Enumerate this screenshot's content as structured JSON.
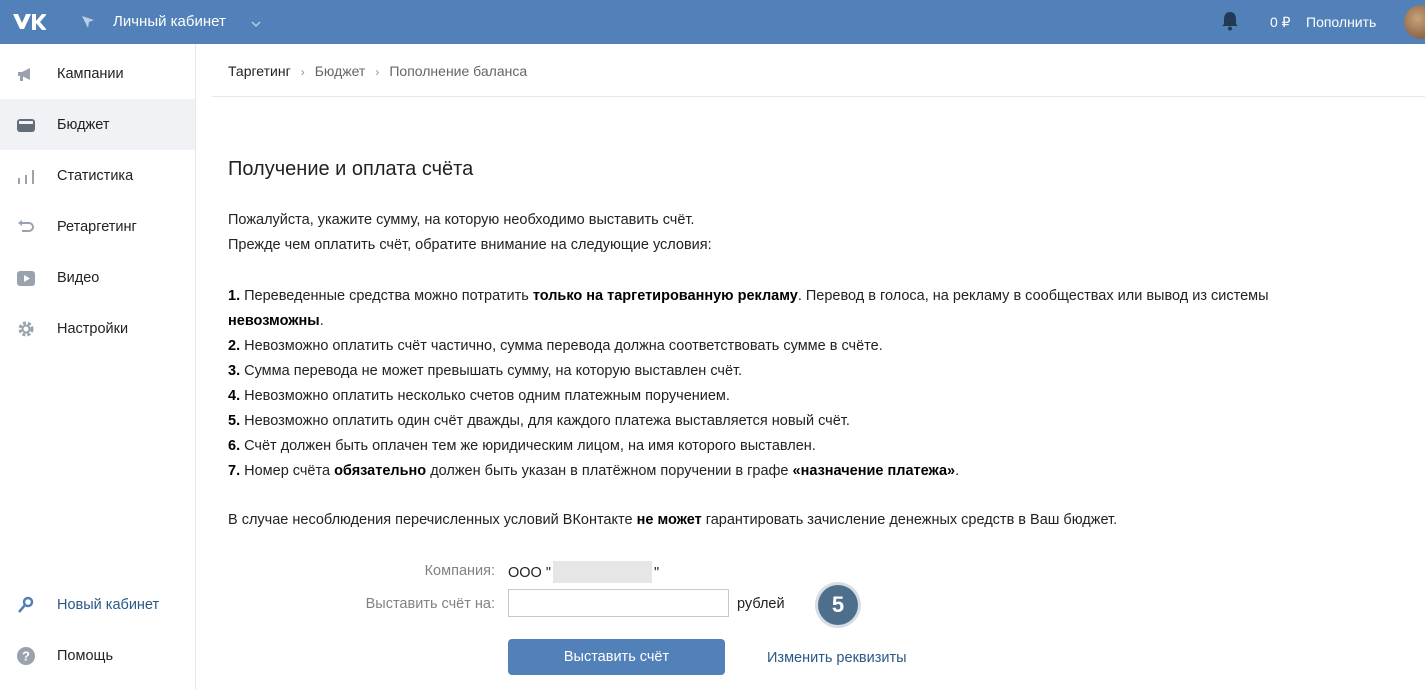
{
  "header": {
    "logo_icon": "vk-logo-icon",
    "title": "Личный кабинет",
    "balance": "0 ₽",
    "topup_label": "Пополнить",
    "accent": "#5181b8"
  },
  "sidebar": {
    "items": [
      {
        "label": "Кампании",
        "icon": "megaphone-icon"
      },
      {
        "label": "Бюджет",
        "icon": "wallet-icon",
        "active": true
      },
      {
        "label": "Статистика",
        "icon": "bar-chart-icon"
      },
      {
        "label": "Ретаргетинг",
        "icon": "retarget-arrow-icon"
      },
      {
        "label": "Видео",
        "icon": "video-play-icon"
      },
      {
        "label": "Настройки",
        "icon": "gear-icon"
      }
    ],
    "bottom": [
      {
        "label": "Новый кабинет",
        "icon": "key-icon"
      },
      {
        "label": "Помощь",
        "icon": "help-icon"
      }
    ]
  },
  "breadcrumb": [
    "Таргетинг",
    "Бюджет",
    "Пополнение баланса"
  ],
  "main": {
    "title": "Получение и оплата счёта",
    "intro_1": "Пожалуйста, укажите сумму, на которую необходимо выставить счёт.",
    "intro_2": "Прежде чем оплатить счёт, обратите внимание на следующие условия:",
    "conditions": {
      "c1_num": "1.",
      "c1_a": "Переведенные средства можно потратить",
      "c1_b": "только на таргетированную рекламу",
      "c1_c": ". Перевод в голоса, на рекламу в сообществах или вывод из системы",
      "c1_d": "невозможны",
      "c1_e": ".",
      "c2_num": "2.",
      "c2": "Невозможно оплатить счёт частично, сумма перевода должна соответствовать сумме в счёте.",
      "c3_num": "3.",
      "c3": "Сумма перевода не может превышать сумму, на которую выставлен счёт.",
      "c4_num": "4.",
      "c4": "Невозможно оплатить несколько счетов одним платежным поручением.",
      "c5_num": "5.",
      "c5": "Невозможно оплатить один счёт дважды, для каждого платежа выставляется новый счёт.",
      "c6_num": "6.",
      "c6": "Счёт должен быть оплачен тем же юридическим лицом, на имя которого выставлен.",
      "c7_num": "7.",
      "c7_a": "Номер счёта",
      "c7_b": "обязательно",
      "c7_c": "должен быть указан в платёжном поручении в графе",
      "c7_d": "«назначение платежа»",
      "c7_e": "."
    },
    "warning_a": "В случае несоблюдения перечисленных условий ВКонтакте",
    "warning_b": "не может",
    "warning_c": "гарантировать зачисление денежных средств в Ваш бюджет."
  },
  "form": {
    "company_label": "Компания:",
    "company_prefix": "ООО \"",
    "company_suffix": "\"",
    "invoice_label": "Выставить счёт на:",
    "amount_value": "",
    "currency": "рублей",
    "step_badge": "5",
    "submit_label": "Выставить счёт",
    "edit_link": "Изменить реквизиты"
  }
}
